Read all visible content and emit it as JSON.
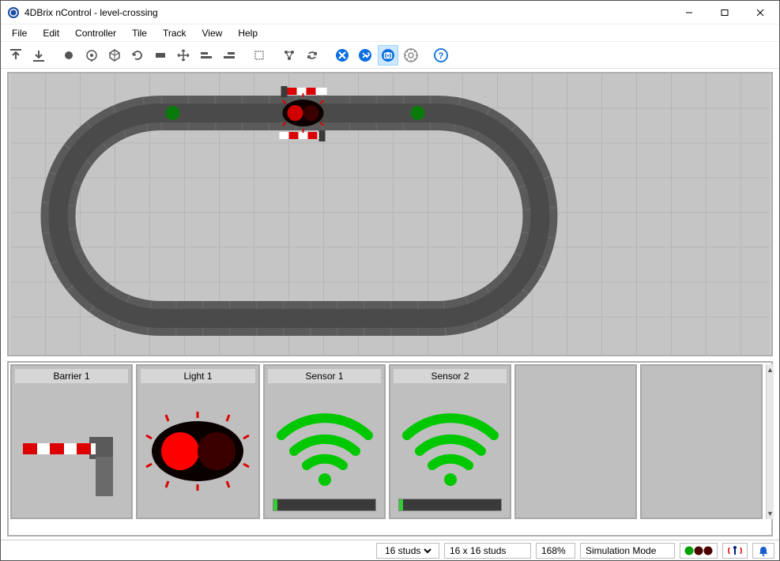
{
  "window": {
    "title": "4DBrix nControl - level-crossing"
  },
  "menu": [
    "File",
    "Edit",
    "Controller",
    "Tile",
    "Track",
    "View",
    "Help"
  ],
  "toolbar": {
    "active_index": 14
  },
  "panels": [
    {
      "label": "Barrier 1"
    },
    {
      "label": "Light 1"
    },
    {
      "label": "Sensor 1"
    },
    {
      "label": "Sensor 2"
    },
    {
      "label": ""
    },
    {
      "label": ""
    }
  ],
  "status": {
    "grid_select": "16 studs",
    "grid_size": "16 x 16 studs",
    "zoom": "168%",
    "mode": "Simulation Mode"
  }
}
